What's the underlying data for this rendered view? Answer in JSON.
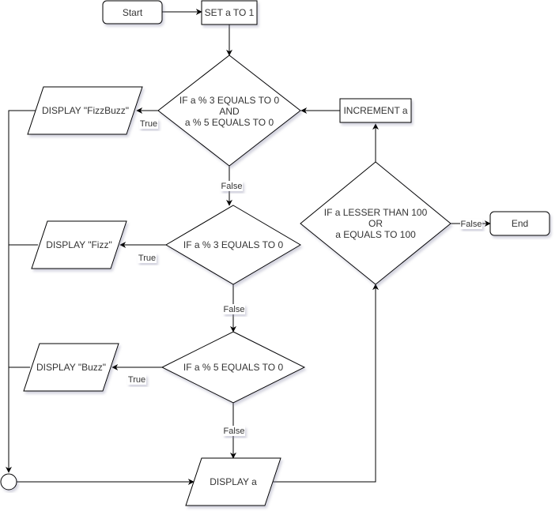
{
  "diagram": {
    "nodes": {
      "start": {
        "label": "Start",
        "shape": "rounded-rect"
      },
      "set_a": {
        "label": "SET a TO 1",
        "shape": "rect"
      },
      "check_fizzbuzz": {
        "lines": [
          "IF a % 3 EQUALS TO 0",
          "AND",
          "a % 5 EQUALS TO 0"
        ],
        "shape": "diamond"
      },
      "display_fizzbuzz": {
        "label": "DISPLAY \"FizzBuzz\"",
        "shape": "parallelogram"
      },
      "check_fizz": {
        "label": "IF a % 3 EQUALS TO 0",
        "shape": "diamond"
      },
      "display_fizz": {
        "label": "DISPLAY \"Fizz\"",
        "shape": "parallelogram"
      },
      "check_buzz": {
        "label": "IF a % 5 EQUALS TO 0",
        "shape": "diamond"
      },
      "display_buzz": {
        "label": "DISPLAY \"Buzz\"",
        "shape": "parallelogram"
      },
      "display_a": {
        "label": "DISPLAY a",
        "shape": "parallelogram"
      },
      "merge": {
        "label": "",
        "shape": "circle"
      },
      "check_loop": {
        "lines": [
          "IF a LESSER THAN 100",
          "OR",
          "a EQUALS TO 100"
        ],
        "shape": "diamond"
      },
      "increment_a": {
        "label": "INCREMENT a",
        "shape": "rect"
      },
      "end": {
        "label": "End",
        "shape": "rounded-rect"
      }
    },
    "edges": [
      {
        "from": "start",
        "to": "set_a",
        "label": ""
      },
      {
        "from": "set_a",
        "to": "check_fizzbuzz",
        "label": ""
      },
      {
        "from": "check_fizzbuzz",
        "to": "display_fizzbuzz",
        "label": "True"
      },
      {
        "from": "check_fizzbuzz",
        "to": "check_fizz",
        "label": "False"
      },
      {
        "from": "check_fizz",
        "to": "display_fizz",
        "label": "True"
      },
      {
        "from": "check_fizz",
        "to": "check_buzz",
        "label": "False"
      },
      {
        "from": "check_buzz",
        "to": "display_buzz",
        "label": "True"
      },
      {
        "from": "check_buzz",
        "to": "display_a",
        "label": "False"
      },
      {
        "from": "display_fizzbuzz",
        "to": "merge",
        "label": ""
      },
      {
        "from": "display_fizz",
        "to": "merge",
        "label": ""
      },
      {
        "from": "display_buzz",
        "to": "merge",
        "label": ""
      },
      {
        "from": "merge",
        "to": "display_a",
        "label": ""
      },
      {
        "from": "display_a",
        "to": "check_loop",
        "label": ""
      },
      {
        "from": "check_loop",
        "to": "increment_a",
        "label": ""
      },
      {
        "from": "check_loop",
        "to": "end",
        "label": "False"
      },
      {
        "from": "increment_a",
        "to": "check_fizzbuzz",
        "label": ""
      }
    ],
    "edge_labels": {
      "true": "True",
      "false": "False"
    }
  }
}
